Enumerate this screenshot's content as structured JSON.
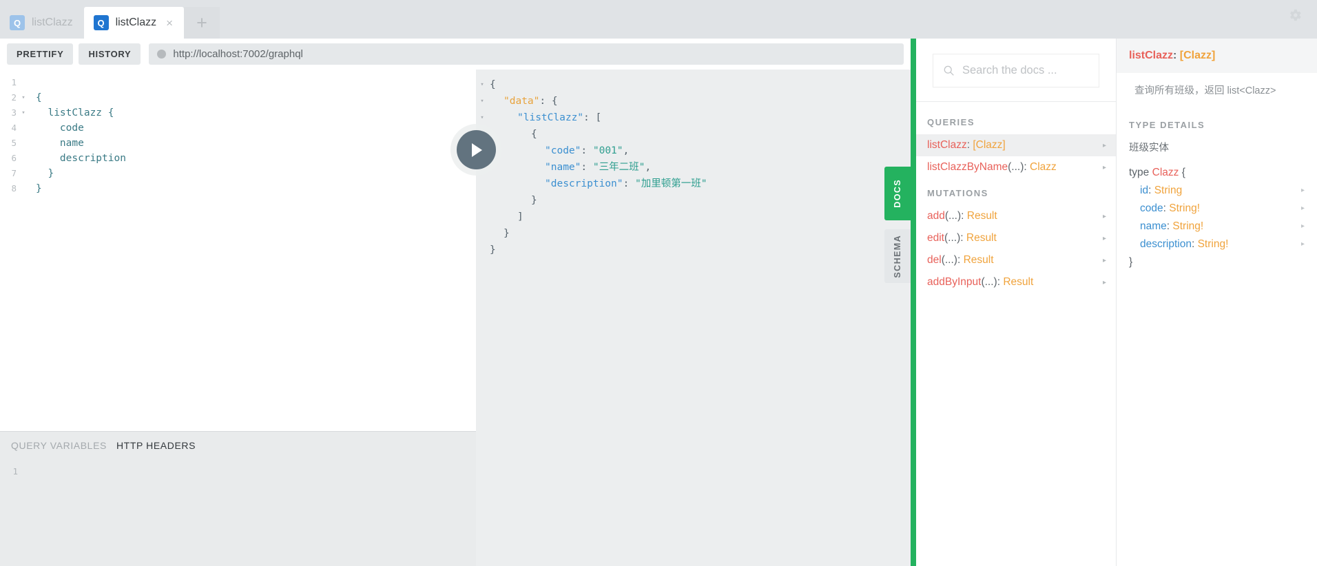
{
  "window": {
    "gear_icon": "gear-icon"
  },
  "tabs": [
    {
      "label": "listClazz",
      "icon": "Q",
      "active": false,
      "closable": false
    },
    {
      "label": "listClazz",
      "icon": "Q",
      "active": true,
      "closable": true,
      "close_label": "×"
    }
  ],
  "tab_add_label": "+",
  "toolbar": {
    "prettify_label": "PRETTIFY",
    "history_label": "HISTORY",
    "url": "http://localhost:7002/graphql",
    "url_dot_icon": "status-dot-icon"
  },
  "run_button": {
    "name": "execute-query-button",
    "icon": "play-icon"
  },
  "editor": {
    "lines": [
      {
        "n": "1",
        "fold": "",
        "text": ""
      },
      {
        "n": "2",
        "fold": "▾",
        "text": "{"
      },
      {
        "n": "3",
        "fold": "▾",
        "text": "  listClazz {"
      },
      {
        "n": "4",
        "fold": "",
        "text": "    code"
      },
      {
        "n": "5",
        "fold": "",
        "text": "    name"
      },
      {
        "n": "6",
        "fold": "",
        "text": "    description"
      },
      {
        "n": "7",
        "fold": "",
        "text": "  }"
      },
      {
        "n": "8",
        "fold": "",
        "text": "}"
      }
    ]
  },
  "variables_section": {
    "tabs": [
      {
        "label": "QUERY VARIABLES",
        "active": false
      },
      {
        "label": "HTTP HEADERS",
        "active": true
      }
    ],
    "lines": [
      {
        "n": "1",
        "text": ""
      }
    ]
  },
  "result": {
    "lines": [
      {
        "fold": "▾",
        "indent": 0,
        "parts": [
          {
            "t": "{",
            "c": "j-punc"
          }
        ]
      },
      {
        "fold": "▾",
        "indent": 1,
        "parts": [
          {
            "t": "\"data\"",
            "c": "j-key-o"
          },
          {
            "t": ": {",
            "c": "j-punc"
          }
        ]
      },
      {
        "fold": "▾",
        "indent": 2,
        "parts": [
          {
            "t": "\"listClazz\"",
            "c": "j-key"
          },
          {
            "t": ": [",
            "c": "j-punc"
          }
        ]
      },
      {
        "fold": "▾",
        "indent": 3,
        "parts": [
          {
            "t": "{",
            "c": "j-punc"
          }
        ]
      },
      {
        "fold": "",
        "indent": 4,
        "parts": [
          {
            "t": "\"code\"",
            "c": "j-key"
          },
          {
            "t": ": ",
            "c": "j-punc"
          },
          {
            "t": "\"001\"",
            "c": "j-str"
          },
          {
            "t": ",",
            "c": "j-punc"
          }
        ]
      },
      {
        "fold": "",
        "indent": 4,
        "parts": [
          {
            "t": "\"name\"",
            "c": "j-key"
          },
          {
            "t": ": ",
            "c": "j-punc"
          },
          {
            "t": "\"三年二班\"",
            "c": "j-str"
          },
          {
            "t": ",",
            "c": "j-punc"
          }
        ]
      },
      {
        "fold": "",
        "indent": 4,
        "parts": [
          {
            "t": "\"description\"",
            "c": "j-key"
          },
          {
            "t": ": ",
            "c": "j-punc"
          },
          {
            "t": "\"加里顿第一班\"",
            "c": "j-str"
          }
        ]
      },
      {
        "fold": "",
        "indent": 3,
        "parts": [
          {
            "t": "}",
            "c": "j-punc"
          }
        ]
      },
      {
        "fold": "",
        "indent": 2,
        "parts": [
          {
            "t": "]",
            "c": "j-punc"
          }
        ]
      },
      {
        "fold": "",
        "indent": 1,
        "parts": [
          {
            "t": "}",
            "c": "j-punc"
          }
        ]
      },
      {
        "fold": "",
        "indent": 0,
        "parts": [
          {
            "t": "}",
            "c": "j-punc"
          }
        ]
      }
    ]
  },
  "side_tabs": [
    {
      "label": "DOCS",
      "active": true
    },
    {
      "label": "SCHEMA",
      "active": false
    }
  ],
  "docs": {
    "search_placeholder": "Search the docs ...",
    "search_icon": "search-icon",
    "sections": [
      {
        "title": "QUERIES",
        "items": [
          {
            "name": "listClazz",
            "args": "",
            "type": "[Clazz]",
            "selected": true,
            "arrow": "▸"
          },
          {
            "name": "listClazzByName",
            "args": "(...)",
            "type": "Clazz",
            "selected": false,
            "arrow": "▸"
          }
        ]
      },
      {
        "title": "MUTATIONS",
        "items": [
          {
            "name": "add",
            "args": "(...)",
            "type": "Result",
            "selected": false,
            "arrow": "▸"
          },
          {
            "name": "edit",
            "args": "(...)",
            "type": "Result",
            "selected": false,
            "arrow": "▸"
          },
          {
            "name": "del",
            "args": "(...)",
            "type": "Result",
            "selected": false,
            "arrow": "▸"
          },
          {
            "name": "addByInput",
            "args": "(...)",
            "type": "Result",
            "selected": false,
            "arrow": "▸"
          }
        ]
      }
    ],
    "detail": {
      "header_name": "listClazz",
      "header_sep": ": ",
      "header_type": "[Clazz]",
      "description": "查询所有班级，返回 list<Clazz>",
      "type_details_title": "TYPE DETAILS",
      "type_description": "班级实体",
      "type_keyword": "type",
      "type_name": "Clazz",
      "type_open": " {",
      "type_close": "}",
      "fields": [
        {
          "field": "id",
          "sep": ": ",
          "type": "String",
          "arrow": "▸"
        },
        {
          "field": "code",
          "sep": ": ",
          "type": "String!",
          "arrow": "▸"
        },
        {
          "field": "name",
          "sep": ": ",
          "type": "String!",
          "arrow": "▸"
        },
        {
          "field": "description",
          "sep": ": ",
          "type": "String!",
          "arrow": "▸"
        }
      ]
    }
  },
  "colors": {
    "accent_green": "#24b25f",
    "tab_active_blue": "#1f75d0",
    "tab_inactive_blue": "#9dc3ea",
    "field_red": "#e8615a",
    "type_orange": "#f0a33c",
    "field_blue": "#3b8fd0",
    "string_teal": "#2e9e8f",
    "run_button_gray": "#62737f"
  }
}
